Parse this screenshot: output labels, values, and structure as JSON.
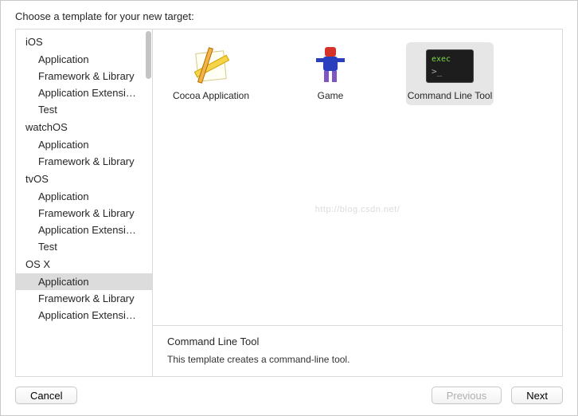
{
  "header": {
    "title": "Choose a template for your new target:"
  },
  "sidebar": {
    "groups": [
      {
        "name": "iOS",
        "items": [
          "Application",
          "Framework & Library",
          "Application Extensi…",
          "Test"
        ]
      },
      {
        "name": "watchOS",
        "items": [
          "Application",
          "Framework & Library"
        ]
      },
      {
        "name": "tvOS",
        "items": [
          "Application",
          "Framework & Library",
          "Application Extensi…",
          "Test"
        ]
      },
      {
        "name": "OS X",
        "items": [
          "Application",
          "Framework & Library",
          "Application Extensi…"
        ]
      }
    ],
    "selected": {
      "group": "OS X",
      "item": "Application"
    }
  },
  "templates": [
    {
      "id": "cocoa",
      "label": "Cocoa Application",
      "icon": "cocoa-app-icon",
      "selected": false
    },
    {
      "id": "game",
      "label": "Game",
      "icon": "game-icon",
      "selected": false
    },
    {
      "id": "clt",
      "label": "Command Line Tool",
      "icon": "terminal-icon",
      "selected": true
    }
  ],
  "desc": {
    "title": "Command Line Tool",
    "text": "This template creates a command-line tool."
  },
  "footer": {
    "cancel": "Cancel",
    "previous": "Previous",
    "next": "Next"
  },
  "watermark": "http://blog.csdn.net/"
}
